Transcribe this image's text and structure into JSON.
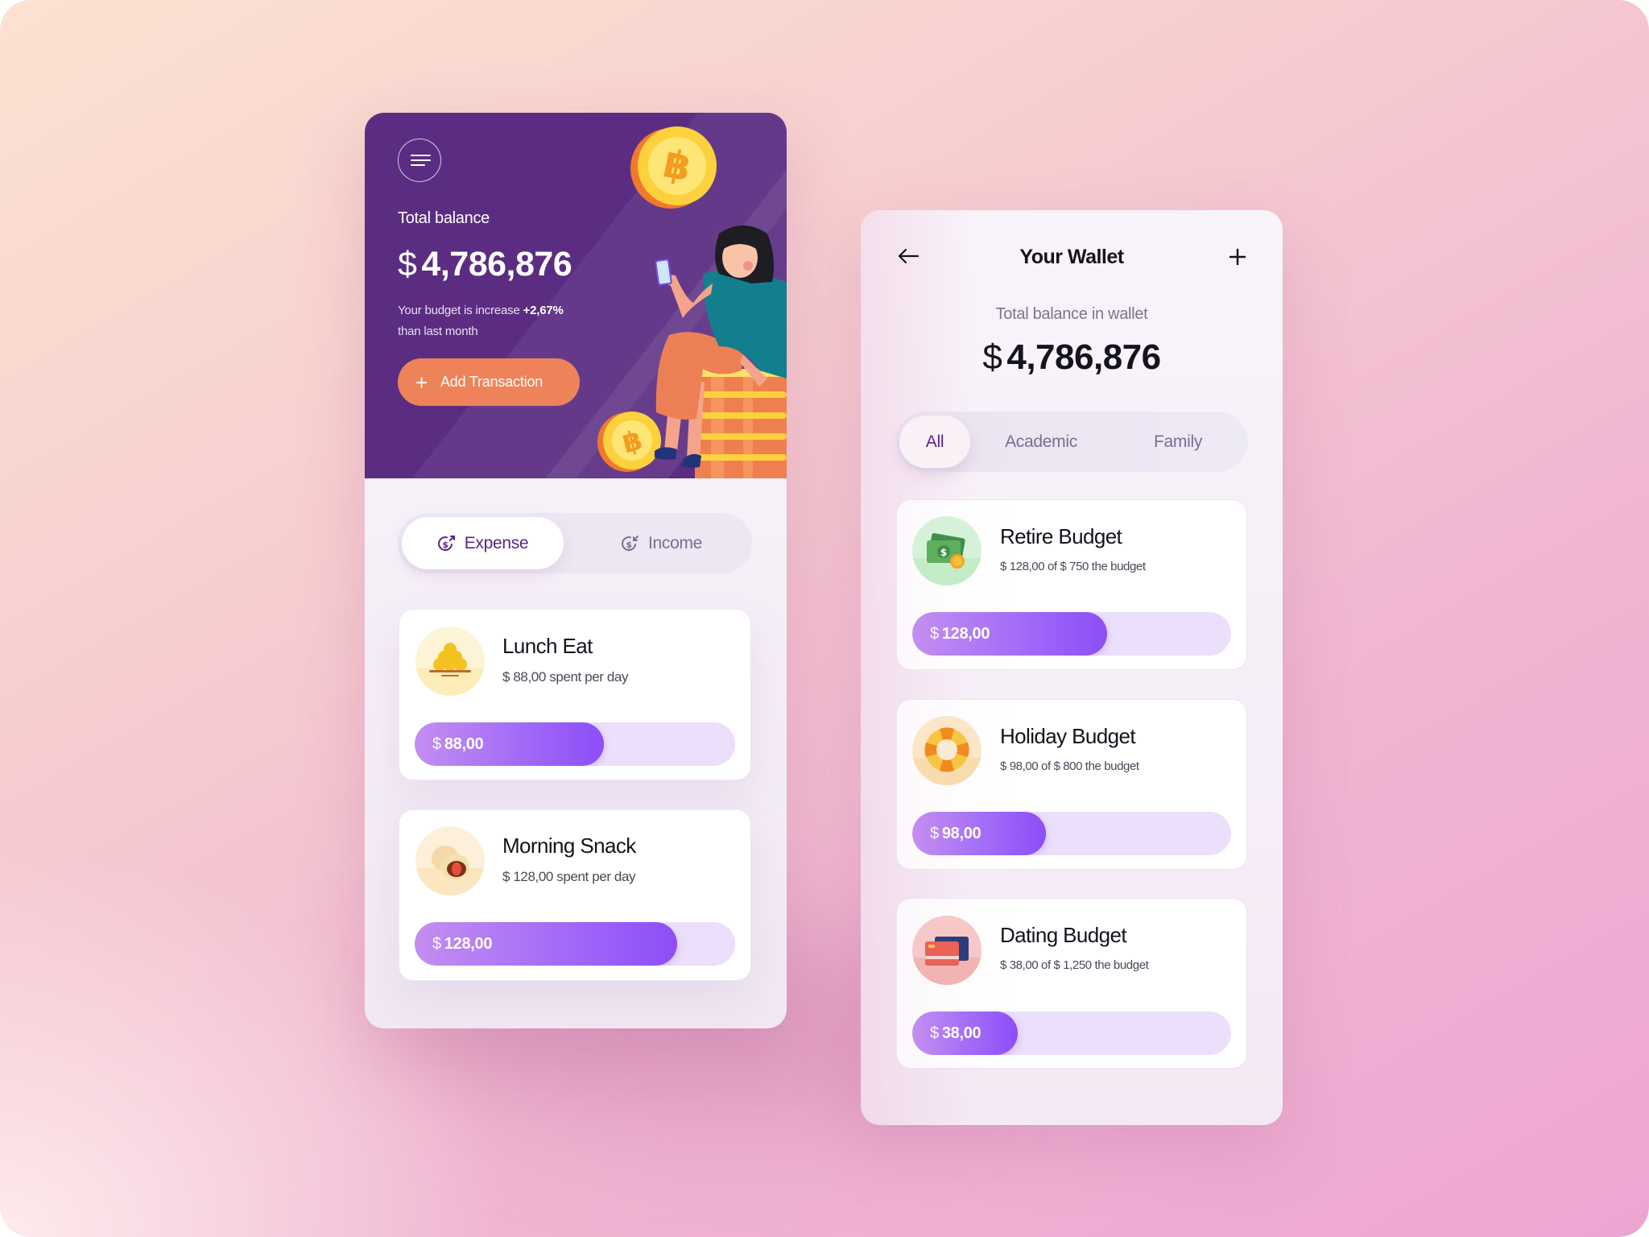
{
  "left_screen": {
    "menu_icon": "hamburger-menu-icon",
    "total_balance_label": "Total balance",
    "currency_symbol": "$",
    "total_balance_value": "4,786,876",
    "budget_note_prefix": "Your budget is increase",
    "budget_note_change": "+2,67%",
    "budget_note_suffix": "than last month",
    "add_transaction_label": "Add Transaction",
    "add_icon": "plus-icon",
    "tabs": [
      {
        "label": "Expense",
        "icon": "dollar-out-icon",
        "active": true
      },
      {
        "label": "Income",
        "icon": "dollar-in-icon",
        "active": false
      }
    ],
    "expenses": [
      {
        "title": "Lunch Eat",
        "subtitle": "$ 88,00 spent per day",
        "bar_currency": "$",
        "bar_value": "88,00",
        "progress": 0.59,
        "icon": "food-bowl-icon"
      },
      {
        "title": "Morning Snack",
        "subtitle": "$ 128,00 spent per day",
        "bar_currency": "$",
        "bar_value": "128,00",
        "progress": 0.82,
        "icon": "mochi-snack-icon"
      }
    ]
  },
  "right_screen": {
    "back_icon": "arrow-left-icon",
    "title": "Your Wallet",
    "add_icon": "plus-icon",
    "total_label": "Total balance in wallet",
    "currency_symbol": "$",
    "total_value": "4,786,876",
    "filters": [
      {
        "label": "All",
        "active": true
      },
      {
        "label": "Academic",
        "active": false
      },
      {
        "label": "Family",
        "active": false
      }
    ],
    "budgets": [
      {
        "title": "Retire Budget",
        "subtitle": "$ 128,00 of $ 750 the budget",
        "bar_currency": "$",
        "bar_value": "128,00",
        "progress": 0.61,
        "icon": "money-cash-icon"
      },
      {
        "title": "Holiday Budget",
        "subtitle": "$ 98,00 of $ 800 the budget",
        "bar_currency": "$",
        "bar_value": "98,00",
        "progress": 0.42,
        "icon": "lifebuoy-icon"
      },
      {
        "title": "Dating Budget",
        "subtitle": "$ 38,00 of $ 1,250 the budget",
        "bar_currency": "$",
        "bar_value": "38,00",
        "progress": 0.33,
        "icon": "credit-card-icon"
      }
    ]
  },
  "colors": {
    "hero_purple": "#5b2d82",
    "accent_orange": "#ee8359",
    "bar_fill": "#8c4ef8",
    "bar_track": "#ecdffc",
    "active_tab_text": "#5b2386"
  }
}
